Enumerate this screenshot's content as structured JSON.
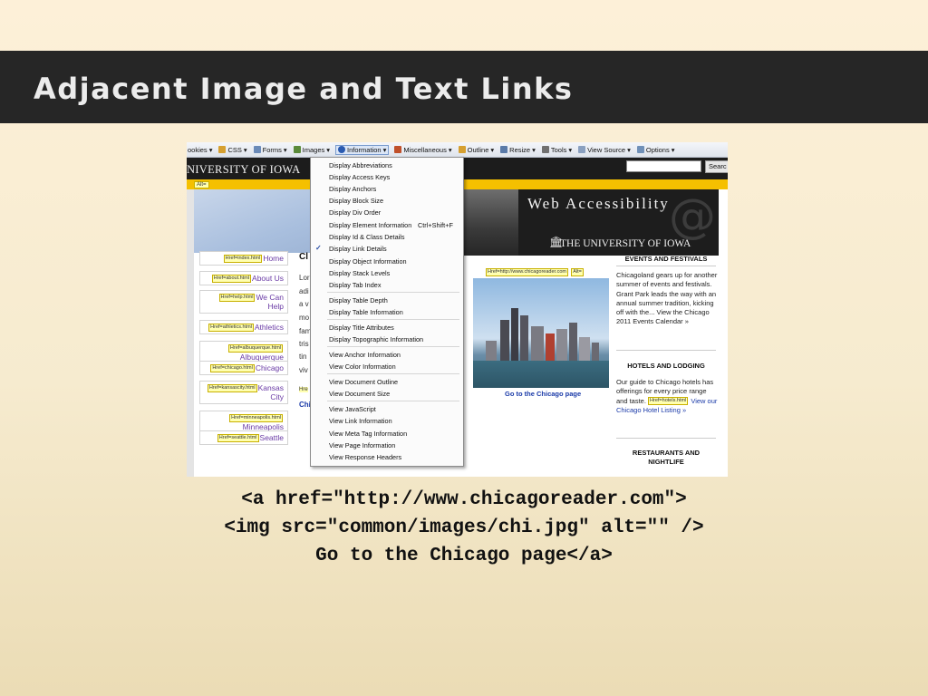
{
  "slide": {
    "title": "Adjacent Image and Text Links",
    "code_lines": [
      "<a href=\"http://www.chicagoreader.com\">",
      "<img src=\"common/images/chi.jpg\" alt=\"\" />",
      "Go to the Chicago page</a>"
    ]
  },
  "toolbar": {
    "items": [
      {
        "label": "ookies",
        "icon": "cookie-icon",
        "color": "#c89040"
      },
      {
        "label": "CSS",
        "icon": "pencil-icon",
        "color": "#d6a030"
      },
      {
        "label": "Forms",
        "icon": "form-icon",
        "color": "#6a8ab8"
      },
      {
        "label": "Images",
        "icon": "image-icon",
        "color": "#5a8a3a"
      },
      {
        "label": "Information",
        "icon": "info-icon",
        "color": "#2a5ab0"
      },
      {
        "label": "Miscellaneous",
        "icon": "toolbox-icon",
        "color": "#c0502a"
      },
      {
        "label": "Outline",
        "icon": "pencil-icon",
        "color": "#d6a030"
      },
      {
        "label": "Resize",
        "icon": "resize-icon",
        "color": "#5a7aa8"
      },
      {
        "label": "Tools",
        "icon": "tools-icon",
        "color": "#707070"
      },
      {
        "label": "View Source",
        "icon": "document-icon",
        "color": "#8aa0c0"
      },
      {
        "label": "Options",
        "icon": "options-icon",
        "color": "#7090b8"
      }
    ]
  },
  "site": {
    "university_name": "NIVERSITY OF IOWA",
    "search_button": "Searc",
    "alt_tag": "Alt=",
    "banner_title": "Web Accessibility",
    "banner_at": "@",
    "banner_university": "THE UNIVERSITY OF IOWA",
    "banner_building_icon": "🏛"
  },
  "nav": {
    "items": [
      {
        "href": "Href=index.html",
        "label": "Home"
      },
      {
        "href": "Href=about.html",
        "label": "About Us"
      },
      {
        "href": "Href=help.html",
        "label": "We Can Help"
      },
      {
        "href": "Href=athletics.html",
        "label": "Athletics"
      },
      {
        "href": "Href=albuquerque.html",
        "label": "Albuquerque"
      },
      {
        "href": "Href=chicago.html",
        "label": "Chicago"
      },
      {
        "href": "Href=kansascity.html",
        "label": "Kansas City"
      },
      {
        "href": "Href=minneapolis.html",
        "label": "Minneapolis"
      },
      {
        "href": "Href=seattle.html",
        "label": "Seattle"
      }
    ]
  },
  "middle": {
    "heading": "Cl",
    "text_fragments": [
      "Lor",
      "adi",
      "a v",
      "mo",
      "fam",
      "tris",
      "tin",
      "viv",
      "Hre",
      "Chi"
    ]
  },
  "chicago": {
    "href_tag": "Href=http://www.chicagoreader.com",
    "alt_tag": "Alt=",
    "link_text": "Go to the Chicago page"
  },
  "right_column": {
    "events_heading": "EVENTS AND FESTIVALS",
    "events_text": "Chicagoland gears up for another summer of events and festivals. Grant Park leads the way with an annual summer tradition, kicking off with the... View the Chicago 2011 Events Calendar »",
    "hotels_heading": "HOTELS AND LODGING",
    "hotels_text": "Our guide to Chicago hotels has offerings for every price range and taste.",
    "hotels_href": "Href=hotels.html",
    "hotels_link": "View our Chicago Hotel Listing »",
    "restaurants_heading": "RESTAURANTS AND NIGHTLIFE"
  },
  "menu": {
    "items": [
      "Display Abbreviations",
      "Display Access Keys",
      "Display Anchors",
      "Display Block Size",
      "Display Div Order",
      "Display Element Information",
      "Display Id & Class Details",
      "Display Link Details",
      "Display Object Information",
      "Display Stack Levels",
      "Display Tab Index",
      "Display Table Depth",
      "Display Table Information",
      "Display Title Attributes",
      "Display Topographic Information",
      "View Anchor Information",
      "View Color Information",
      "View Document Outline",
      "View Document Size",
      "View JavaScript",
      "View Link Information",
      "View Meta Tag Information",
      "View Page Information",
      "View Response Headers"
    ],
    "shortcut": "Ctrl+Shift+F",
    "checked_label": "✓"
  }
}
